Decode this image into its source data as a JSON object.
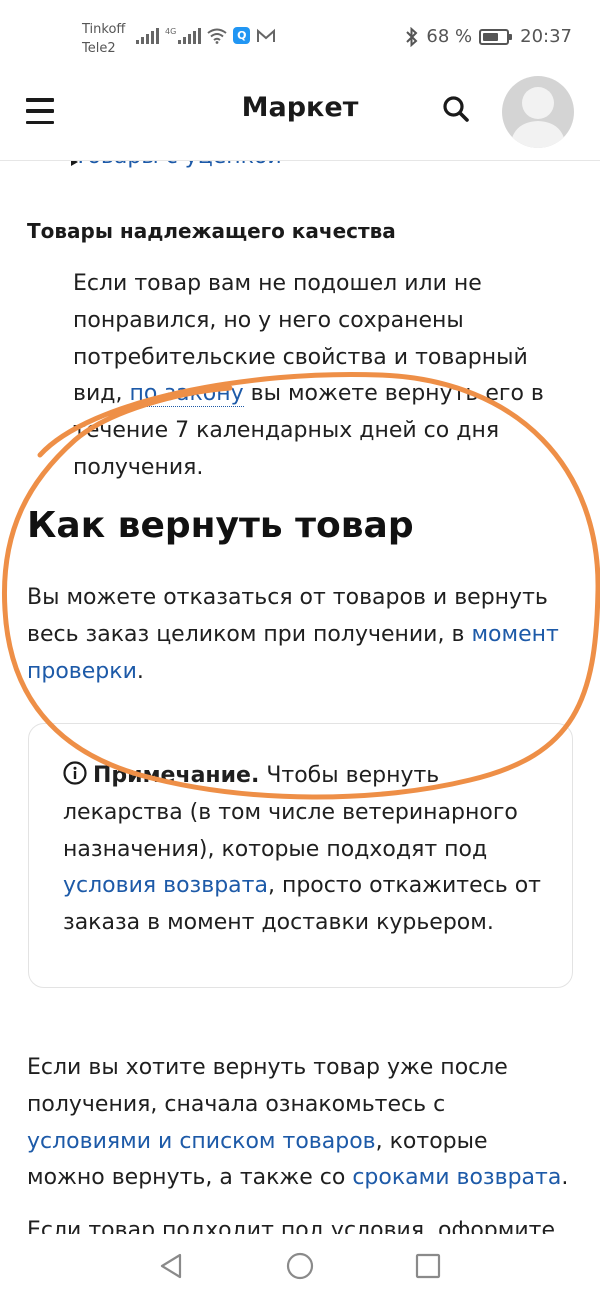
{
  "status": {
    "carrier_1": "Tinkoff",
    "carrier_2": "Tele2",
    "network_label": "4G",
    "battery": "68 %",
    "battery_level": 0.68,
    "time": "20:37"
  },
  "header": {
    "title": "Маркет"
  },
  "content": {
    "peek_link": "Товары с уценкой",
    "section_heading": "Товары надлежащего качества",
    "quality_text_1": "Если товар вам не подошел или не понравился, но у него сохранены потребительские свойства и товарный вид, ",
    "quality_link": "по закону",
    "quality_text_2": " вы можете вернуть его в течение 7 календарных дней со дня получения.",
    "return_heading": "Как вернуть товар",
    "return_text": "Вы можете отказаться от товаров и вернуть весь заказ целиком при получении, в ",
    "return_link": "момент проверки",
    "return_end": ".",
    "note_label": "Примечание.",
    "note_text_1": " Чтобы вернуть лекарства (в том числе ветеринарного назначения), которые подходят под ",
    "note_link": "условия возврата",
    "note_text_2": ", просто откажитесь от заказа в момент доставки курьером.",
    "after_text_1": "Если вы хотите вернуть товар уже после получения, сначала ознакомьтесь с ",
    "after_link_1": "условиями и списком товаров",
    "after_text_2": ", которые можно вернуть, а также со ",
    "after_link_2": "сроками возврата",
    "after_end": ".",
    "cut_text": "Если товар подходит под условия, оформите"
  },
  "colors": {
    "link": "#1d5aa8",
    "annotation_stroke": "#ee8f47",
    "text": "#1f1f1f"
  },
  "icons": [
    "menu-icon",
    "search-icon",
    "avatar",
    "info-icon",
    "nav-back-icon",
    "nav-home-icon",
    "nav-recents-icon"
  ]
}
